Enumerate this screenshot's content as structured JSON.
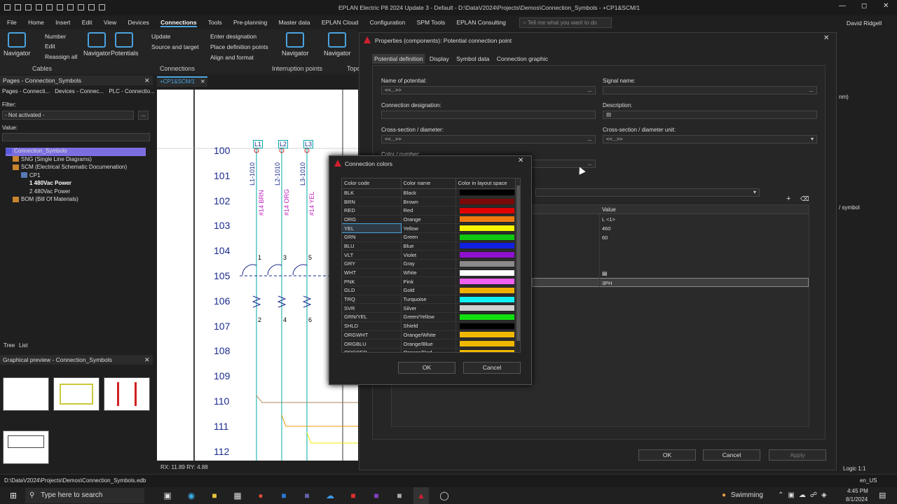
{
  "window": {
    "title": "EPLAN Electric P8 2024 Update 3 - Default - D:\\DataV2024\\Projects\\Demos\\Connection_Symbols - +CP1&SCM/1",
    "user": "David Ridgell"
  },
  "menu": [
    "File",
    "Home",
    "Insert",
    "Edit",
    "View",
    "Devices",
    "Connections",
    "Tools",
    "Pre-planning",
    "Master data",
    "EPLAN Cloud",
    "Configuration",
    "SPM Tools",
    "EPLAN Consulting"
  ],
  "search_placeholder": "Tell me what you want to do",
  "ribbon": {
    "navigator": "Navigator",
    "number": "Number",
    "edit": "Edit",
    "reassign": "Reassign all",
    "cables": "Cables",
    "nav2": "Navigator",
    "potentials": "Potentials",
    "update": "Update",
    "source_target": "Source and target",
    "enter_designation": "Enter designation",
    "place_points": "Place definition points",
    "align_format": "Align and format",
    "connections": "Connections",
    "nav3": "Navigator",
    "interruption": "Interruption points",
    "nav4": "Navigator",
    "topo": "Topo"
  },
  "pages_panel": {
    "title": "Pages - Connection_Symbols",
    "tabs": [
      "Pages - Connecti...",
      "Devices - Connec...",
      "PLC - Connectio..."
    ],
    "filter_label": "Filter:",
    "filter_value": "- Not activated -",
    "value_label": "Value:",
    "tree": [
      "Connection_Symbols",
      "SNG (Single Line Diagrams)",
      "SCM (Electrical Schematic Documenation)",
      "CP1",
      "1 480Vac Power",
      "2 480Vac Power",
      "BOM (Bill Of Materials)"
    ],
    "bottom_tabs": [
      "Tree",
      "List"
    ]
  },
  "preview_panel": {
    "title": "Graphical preview - Connection_Symbols"
  },
  "doc_tab": "+CP1&SCM/1",
  "schematic": {
    "rows": [
      "100",
      "101",
      "102",
      "103",
      "104",
      "105",
      "106",
      "107",
      "108",
      "109",
      "110",
      "111",
      "112"
    ],
    "terminals": [
      "L1",
      "L2",
      "L3"
    ],
    "wires": [
      "L1-1010",
      "L2-1010",
      "L3-1010"
    ],
    "gauges": [
      "#14 BRN",
      "#14 ORG",
      "#14 YEL"
    ],
    "pins_top": [
      "1",
      "3",
      "5"
    ],
    "pins_bottom": [
      "2",
      "4",
      "6"
    ],
    "coords": "RX: 11.89 RY: 4.88"
  },
  "props": {
    "title": "Properties (components): Potential connection point",
    "tabs": [
      "Potential definition",
      "Display",
      "Symbol data",
      "Connection graphic"
    ],
    "name_label": "Name of potential:",
    "name_value": "<<...>>",
    "signal_label": "Signal name:",
    "conn_label": "Connection designation:",
    "desc_label": "Description:",
    "cs_label": "Cross-section / diameter:",
    "cs_value": "<<...>>",
    "csu_label": "Cross-section / diameter unit:",
    "csu_value": "<<...>>",
    "color_label": "Color / number:",
    "value_header": "Value",
    "values": [
      "L <1>",
      "460",
      "60",
      "",
      "",
      "",
      "3PH"
    ],
    "ok": "OK",
    "cancel": "Cancel",
    "apply": "Apply",
    "side_text": "/ symbol",
    "side_text2": "nm)"
  },
  "colors_dialog": {
    "title": "Connection colors",
    "headers": [
      "Color code",
      "Color name",
      "Color in layout space"
    ],
    "rows": [
      {
        "code": "BLK",
        "name": "Black",
        "color": "#000000"
      },
      {
        "code": "BRN",
        "name": "Brown",
        "color": "#7a0a0a"
      },
      {
        "code": "RED",
        "name": "Red",
        "color": "#e00000"
      },
      {
        "code": "ORG",
        "name": "Orange",
        "color": "#f07a10"
      },
      {
        "code": "YEL",
        "name": "Yellow",
        "color": "#f5f500"
      },
      {
        "code": "GRN",
        "name": "Green",
        "color": "#10c810"
      },
      {
        "code": "BLU",
        "name": "Blue",
        "color": "#1020e0"
      },
      {
        "code": "VLT",
        "name": "Violet",
        "color": "#9010d0"
      },
      {
        "code": "GRY",
        "name": "Gray",
        "color": "#8a8a8a"
      },
      {
        "code": "WHT",
        "name": "White",
        "color": "#ffffff"
      },
      {
        "code": "PNK",
        "name": "Pink",
        "color": "#f060f0"
      },
      {
        "code": "GLD",
        "name": "Gold",
        "color": "#f0b000"
      },
      {
        "code": "TRQ",
        "name": "Turquoise",
        "color": "#10f0f0"
      },
      {
        "code": "SVR",
        "name": "Silver",
        "color": "#d0d0d0"
      },
      {
        "code": "GRN/YEL",
        "name": "Green/Yellow",
        "color": "#10e010"
      },
      {
        "code": "SHLD",
        "name": "Shield",
        "color": "#000000"
      },
      {
        "code": "ORGWHT",
        "name": "Orange/White",
        "color": "#f0b800"
      },
      {
        "code": "ORGBLU",
        "name": "Orange/Blue",
        "color": "#f0b800"
      },
      {
        "code": "ORGRED",
        "name": "Orange/Red",
        "color": "#f0b800"
      }
    ],
    "selected": 4,
    "ok": "OK",
    "cancel": "Cancel"
  },
  "status": {
    "path": "D:\\DataV2024\\Projects\\Demos\\Connection_Symbols.edb",
    "logic": "Logic 1:1",
    "locale": "en_US"
  },
  "taskbar": {
    "search": "Type here to search",
    "weather": "Swimming",
    "time": "4:45 PM",
    "date": "8/1/2024"
  }
}
